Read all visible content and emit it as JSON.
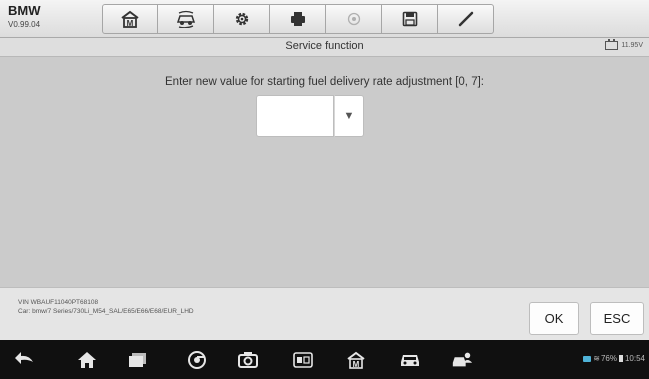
{
  "header": {
    "brand": "BMW",
    "version": "V0.99.04"
  },
  "toolbar": {
    "tools": [
      {
        "icon": "home-m-icon"
      },
      {
        "icon": "vehicle-swap-icon"
      },
      {
        "icon": "settings-gear-icon"
      },
      {
        "icon": "print-icon"
      },
      {
        "icon": "help-icon"
      },
      {
        "icon": "save-icon"
      },
      {
        "icon": "edit-pen-icon"
      }
    ]
  },
  "titlebar": {
    "title": "Service function",
    "voltage": "11.95V"
  },
  "main": {
    "prompt": "Enter new value for starting fuel delivery rate adjustment [0, 7]:",
    "select_value": "",
    "dropdown_arrow": "▼"
  },
  "info": {
    "vin": "VIN WBAUF11040PT68108",
    "car": "Car: bmw/7 Series/730Li_M54_SAL/E65/E66/E68/EUR_LHD"
  },
  "buttons": {
    "ok": "OK",
    "esc": "ESC"
  },
  "navbar": {
    "items": [
      "back-icon",
      "home-icon",
      "recent-apps-icon",
      "chrome-icon",
      "camera-icon",
      "screen-switch-icon",
      "autel-home-icon",
      "car-icon",
      "car-user-icon"
    ],
    "battery_percent": "76%",
    "time": "10:54"
  }
}
